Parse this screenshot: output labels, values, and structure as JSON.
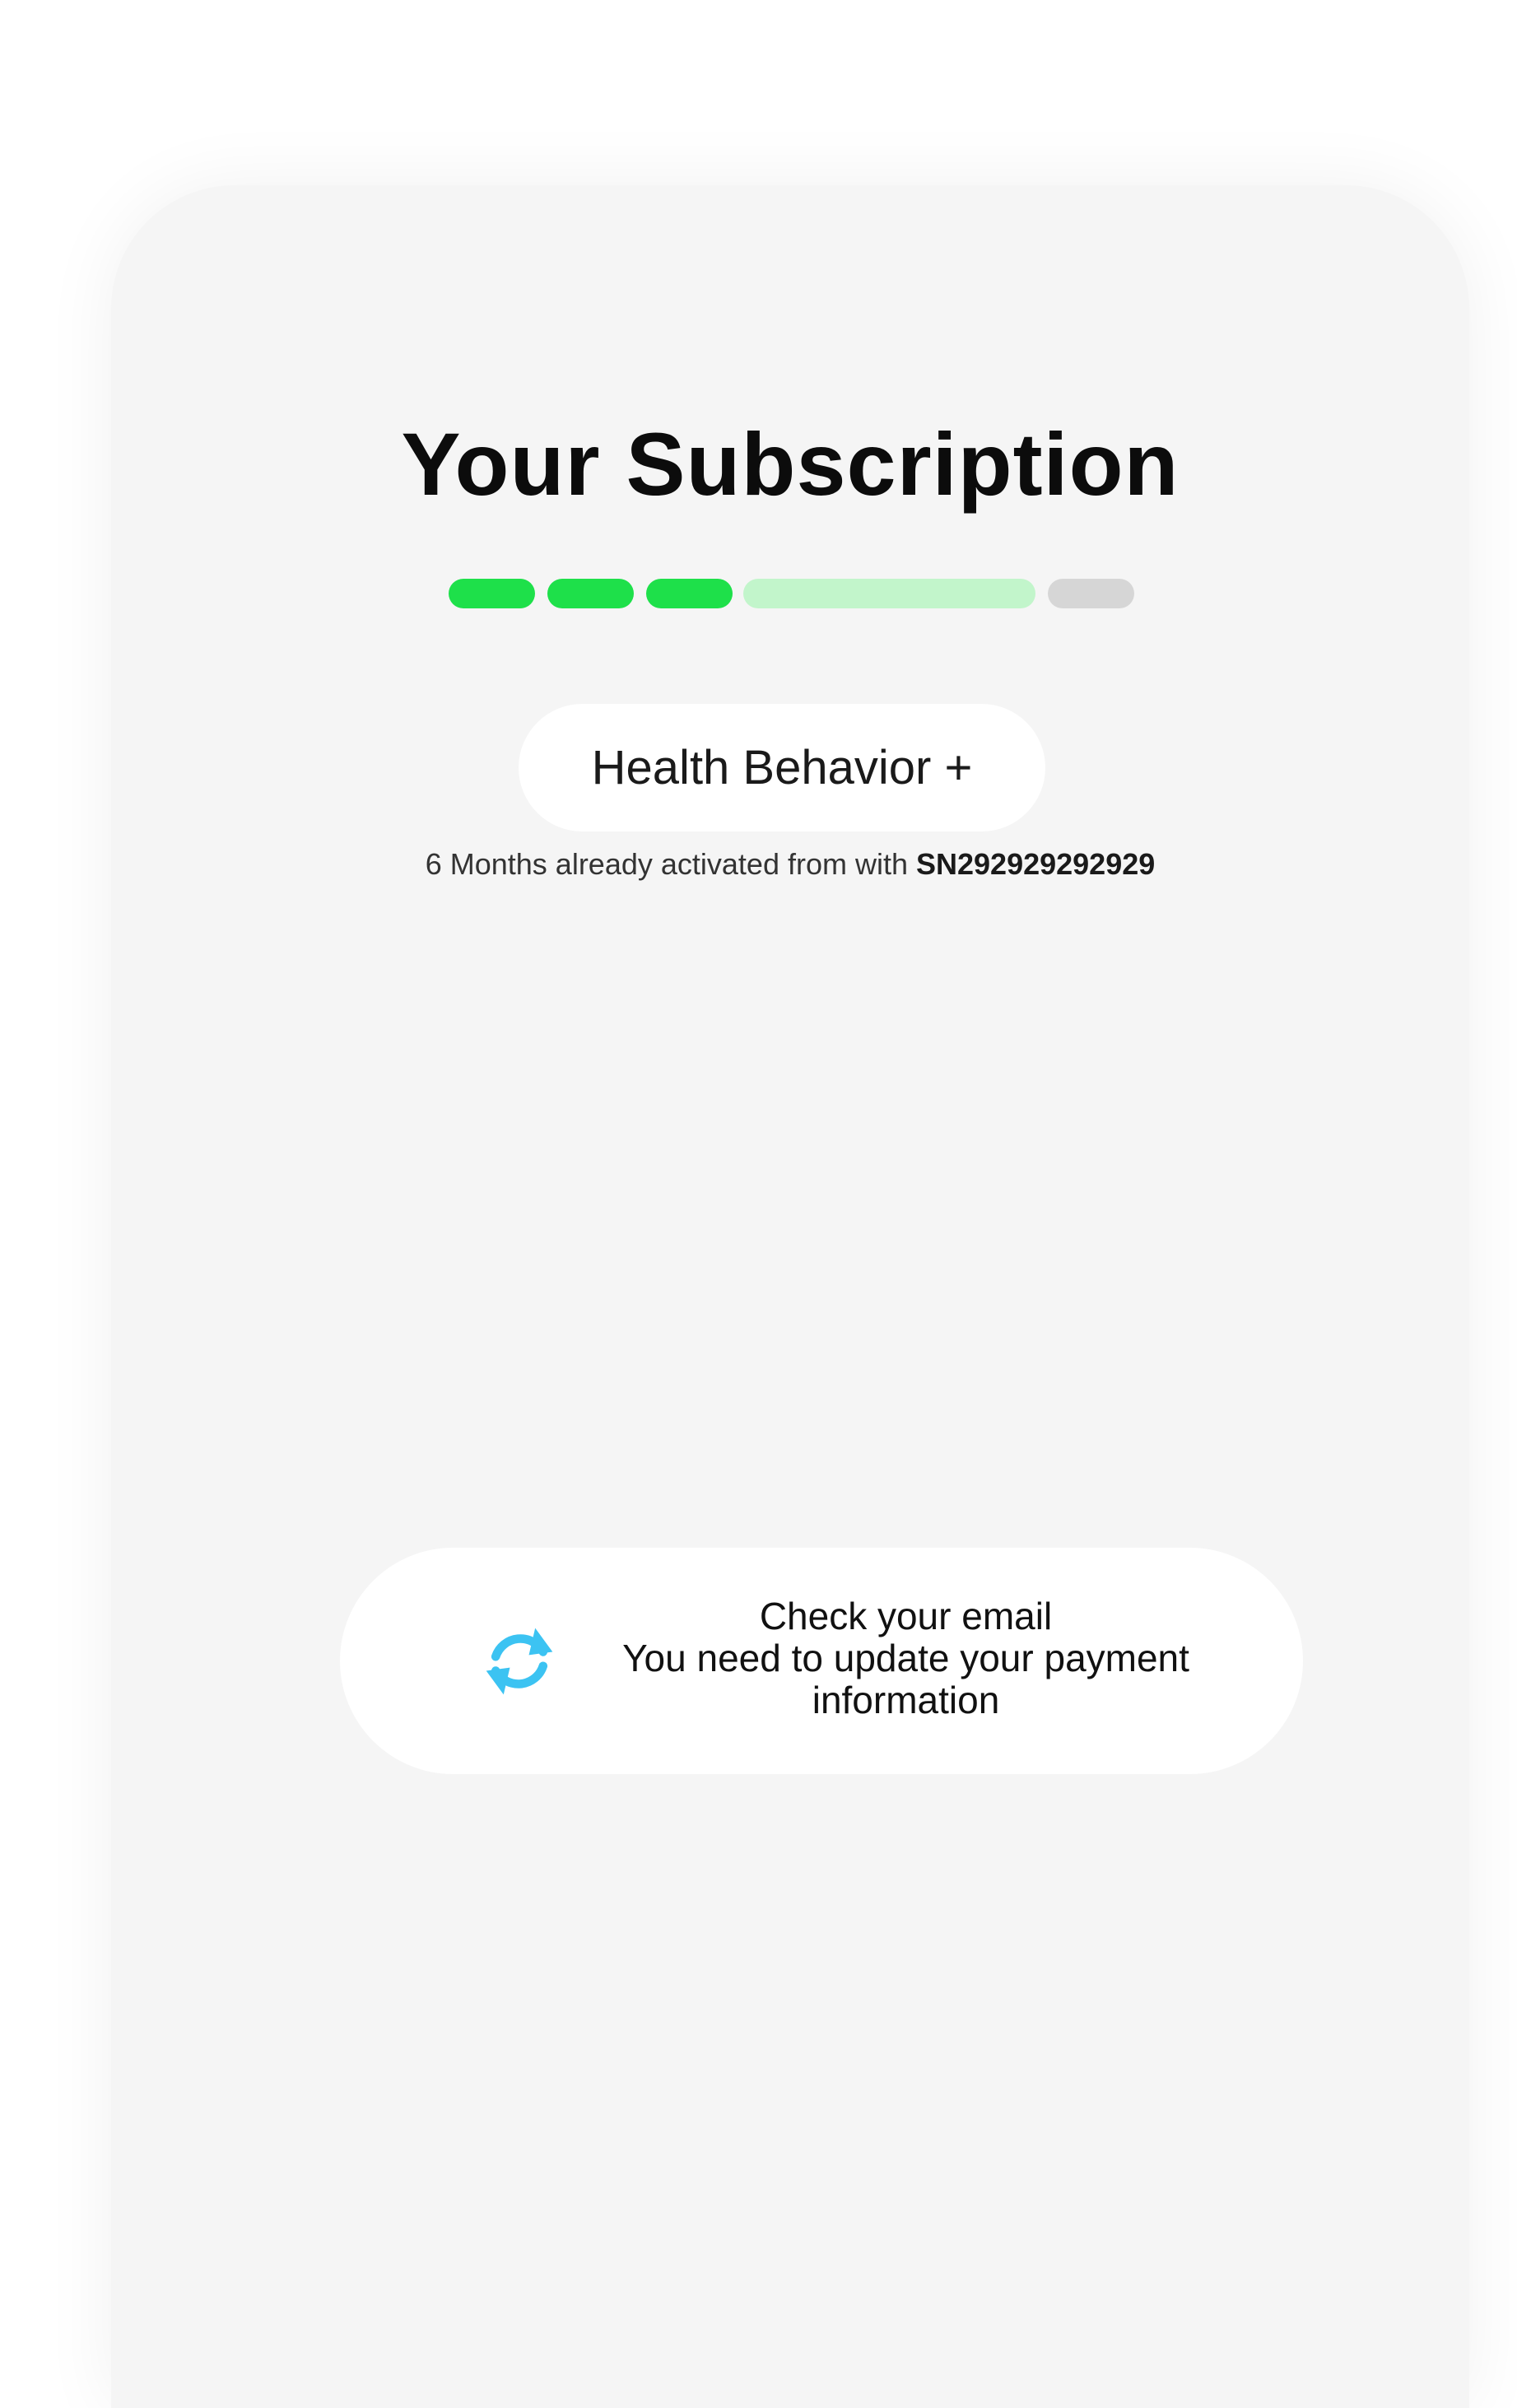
{
  "screen": {
    "title": "Your Subscription"
  },
  "progress": {
    "completed_steps": 3,
    "current_step": 4,
    "total_steps": 5,
    "colors": {
      "completed": "#1ee04a",
      "current": "#c2f5cb",
      "remaining": "#d6d6d6"
    }
  },
  "plan": {
    "name": "Health Behavior +"
  },
  "activation": {
    "text": "6 Months already activated from with",
    "serial": "SN292929292929"
  },
  "notice": {
    "icon": "sync-icon",
    "icon_color": "#3cc3f2",
    "line1": "Check your email",
    "line2": "You need to update your payment",
    "line3": "information"
  }
}
